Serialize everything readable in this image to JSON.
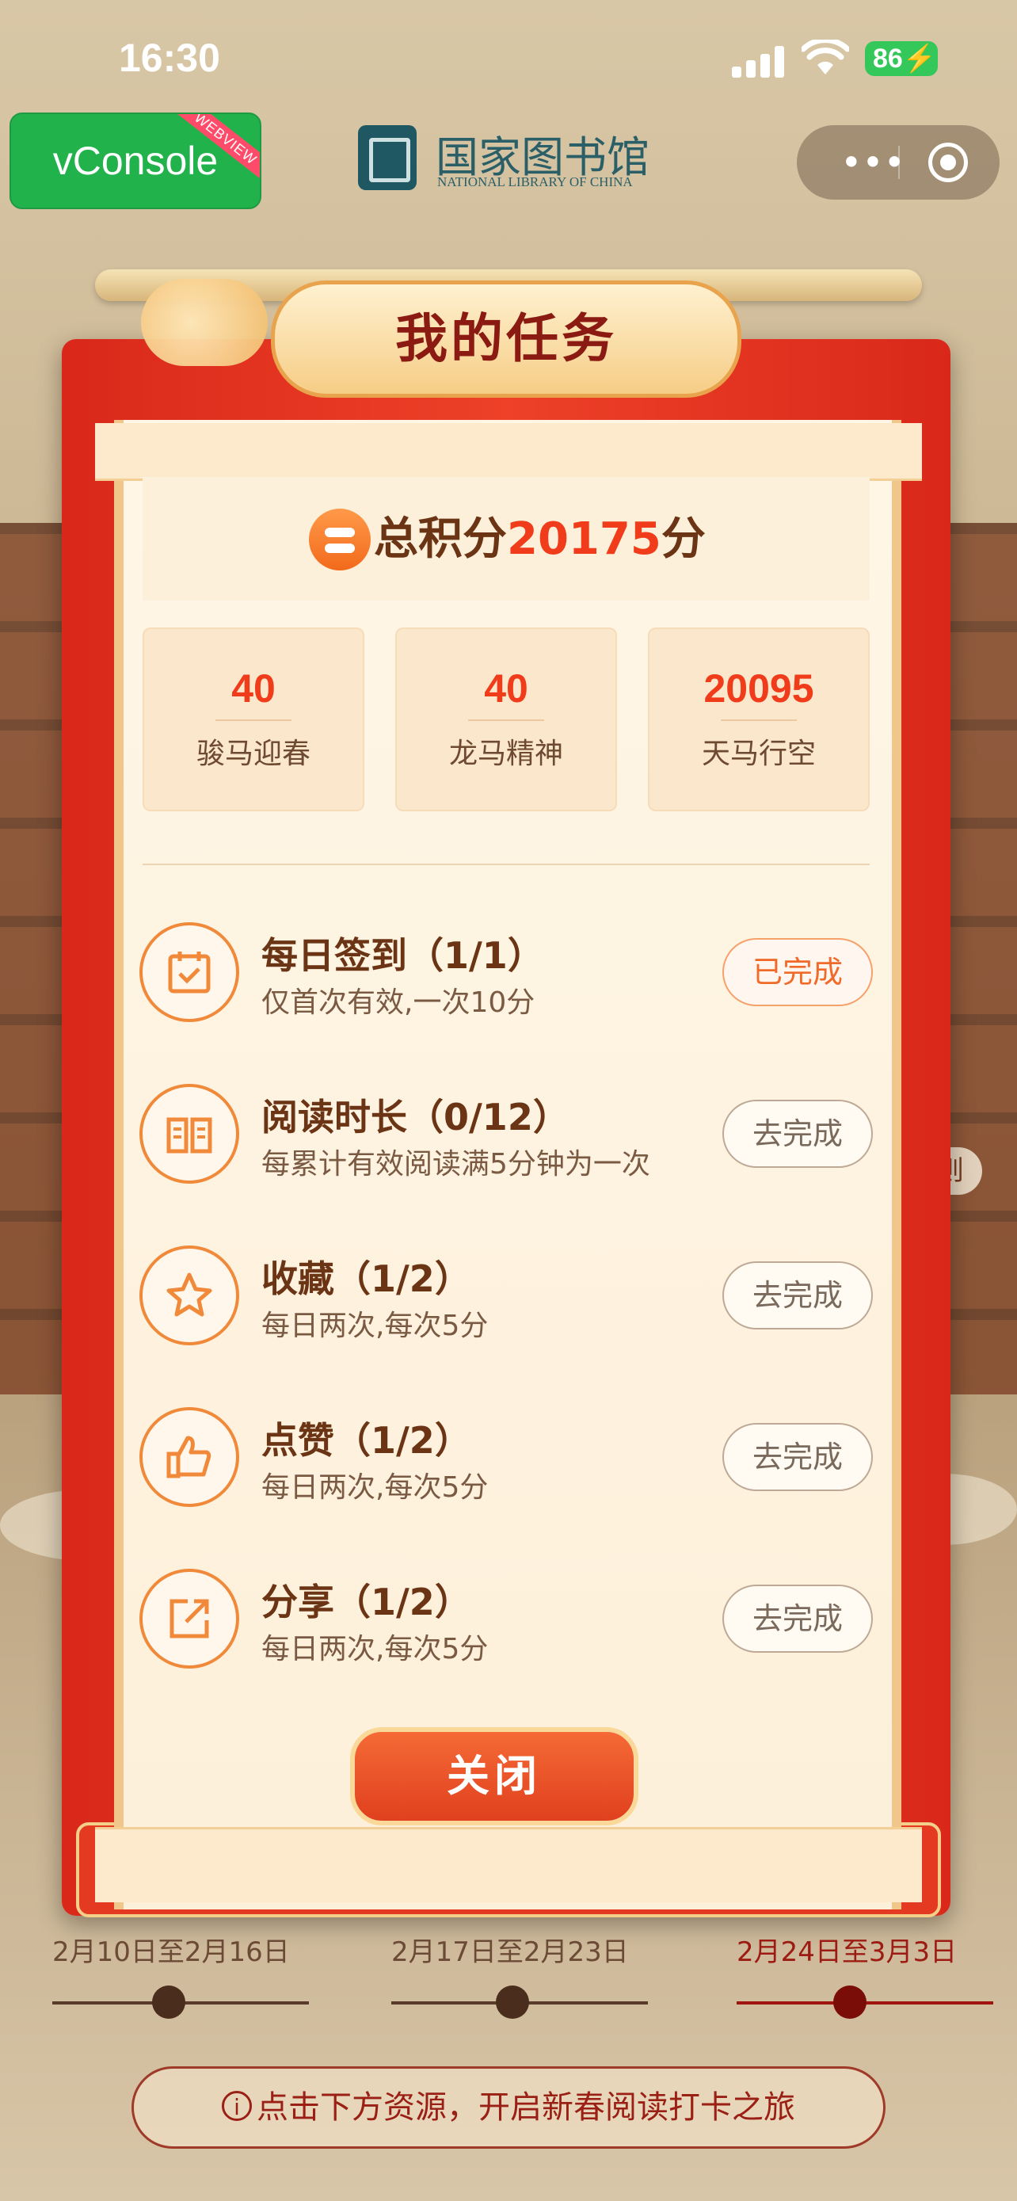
{
  "status_bar": {
    "time": "16:30",
    "battery": "86"
  },
  "header": {
    "vconsole": "vConsole",
    "webview_ribbon": "WEBVIEW",
    "logo_cn": "国家图书馆",
    "logo_en": "NATIONAL LIBRARY OF CHINA",
    "more_glyph": "•••"
  },
  "modal": {
    "title": "我的任务",
    "total": {
      "prefix": "总积分",
      "value": "20175",
      "suffix": "分"
    },
    "stats": [
      {
        "value": "40",
        "label": "骏马迎春"
      },
      {
        "value": "40",
        "label": "龙马精神"
      },
      {
        "value": "20095",
        "label": "天马行空"
      }
    ],
    "tasks": [
      {
        "icon": "calendar-check-icon",
        "title": "每日签到（1/1）",
        "desc": "仅首次有效,一次10分",
        "button": "已完成",
        "done": true
      },
      {
        "icon": "open-book-icon",
        "title": "阅读时长（0/12）",
        "desc": "每累计有效阅读满5分钟为一次",
        "button": "去完成",
        "done": false
      },
      {
        "icon": "star-icon",
        "title": "收藏（1/2）",
        "desc": "每日两次,每次5分",
        "button": "去完成",
        "done": false
      },
      {
        "icon": "thumbs-up-icon",
        "title": "点赞（1/2）",
        "desc": "每日两次,每次5分",
        "button": "去完成",
        "done": false
      },
      {
        "icon": "share-icon",
        "title": "分享（1/2）",
        "desc": "每日两次,每次5分",
        "button": "去完成",
        "done": false
      }
    ],
    "close_label": "关闭"
  },
  "background": {
    "rules_fragment": "则",
    "dates": [
      "2月10日至2月16日",
      "2月17日至2月23日",
      "2月24日至3月3日"
    ],
    "hint": "点击下方资源，开启新春阅读打卡之旅",
    "hint_icon": "i"
  },
  "colors": {
    "accent_red": "#f03c1a",
    "done_orange": "#f06a2a",
    "brown_text": "#6b3414",
    "vconsole_green": "#22b24c"
  }
}
